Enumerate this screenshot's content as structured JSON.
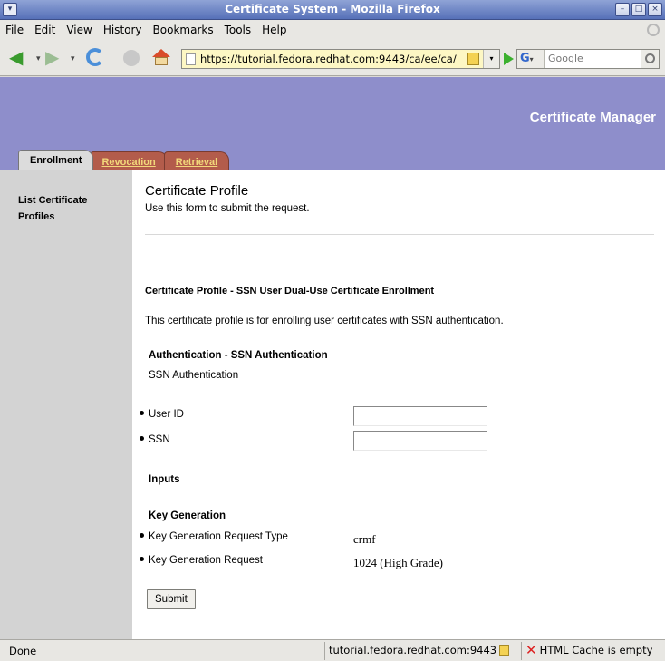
{
  "window": {
    "title": "Certificate System - Mozilla Firefox"
  },
  "menu": [
    "File",
    "Edit",
    "View",
    "History",
    "Bookmarks",
    "Tools",
    "Help"
  ],
  "navbar": {
    "url": "https://tutorial.fedora.redhat.com:9443/ca/ee/ca/",
    "search_placeholder": "Google",
    "search_engine_glyph": "G"
  },
  "banner": {
    "brand": "Certificate Manager"
  },
  "tabs": [
    {
      "label": "Enrollment",
      "active": true
    },
    {
      "label": "Revocation",
      "active": false
    },
    {
      "label": "Retrieval",
      "active": false
    }
  ],
  "sidebar": {
    "link": "List Certificate Profiles"
  },
  "content": {
    "title": "Certificate Profile",
    "subtitle": "Use this form to submit the request.",
    "profile_name": "Certificate Profile - SSN User Dual-Use Certificate Enrollment",
    "profile_description": "This certificate profile is for enrolling user certificates with SSN authentication.",
    "auth_title": "Authentication - SSN Authentication",
    "auth_name": "SSN Authentication",
    "fields": [
      {
        "label": "User ID",
        "value": ""
      },
      {
        "label": "SSN",
        "value": ""
      }
    ],
    "inputs_title": "Inputs",
    "keygen_title": "Key Generation",
    "keygen_rows": [
      {
        "label": "Key Generation Request Type",
        "value": "crmf"
      },
      {
        "label": "Key Generation Request",
        "value": "1024 (High Grade)"
      }
    ],
    "submit_label": "Submit"
  },
  "status": {
    "left": "Done",
    "host": "tutorial.fedora.redhat.com:9443",
    "cache": "HTML Cache is empty"
  },
  "colors": {
    "banner": "#8e8ecb",
    "sidebar": "#d3d3d3",
    "tab_inactive": "#b35c4b",
    "tab_inactive_text": "#f2d87a"
  }
}
